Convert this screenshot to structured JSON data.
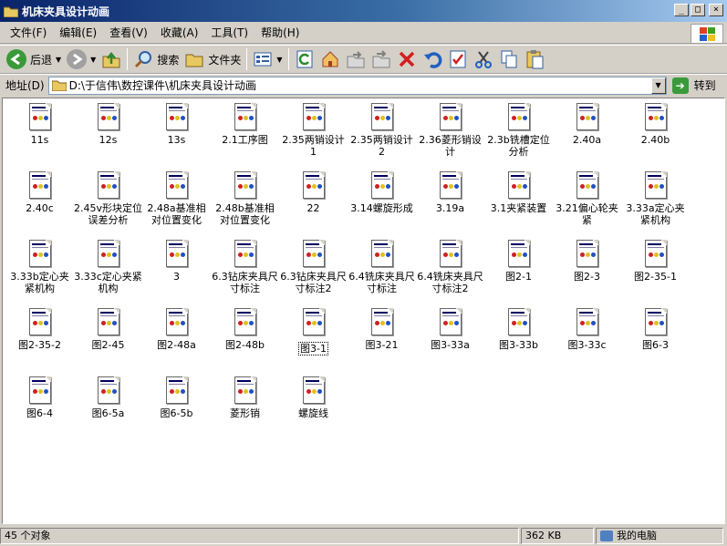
{
  "window": {
    "title": "机床夹具设计动画"
  },
  "menu": [
    "文件(F)",
    "编辑(E)",
    "查看(V)",
    "收藏(A)",
    "工具(T)",
    "帮助(H)"
  ],
  "toolbar": {
    "back_label": "后退",
    "search_label": "搜索",
    "folders_label": "文件夹"
  },
  "address": {
    "label": "地址(D)",
    "value": "D:\\于信伟\\数控课件\\机床夹具设计动画",
    "go_label": "转到"
  },
  "files": [
    "11s",
    "12s",
    "13s",
    "2.1工序图",
    "2.35两销设计1",
    "2.35两销设计2",
    "2.36菱形销设计",
    "2.3b铣槽定位分析",
    "2.40a",
    "2.40b",
    "2.40c",
    "2.45v形块定位误差分析",
    "2.48a基准相对位置变化",
    "2.48b基准相对位置变化",
    "22",
    "3.14螺旋形成",
    "3.19a",
    "3.1夹紧装置",
    "3.21偏心轮夹紧",
    "3.33a定心夹紧机构",
    "3.33b定心夹紧机构",
    "3.33c定心夹紧机构",
    "3",
    "6.3钻床夹具尺寸标注",
    "6.3钻床夹具尺寸标注2",
    "6.4铣床夹具尺寸标注",
    "6.4铣床夹具尺寸标注2",
    "图2-1",
    "图2-3",
    "图2-35-1",
    "图2-35-2",
    "图2-45",
    "图2-48a",
    "图2-48b",
    "图3-1",
    "图3-21",
    "图3-33a",
    "图3-33b",
    "图3-33c",
    "图6-3",
    "图6-4",
    "图6-5a",
    "图6-5b",
    "菱形销",
    "螺旋线"
  ],
  "selected_index": 34,
  "status": {
    "count": "45 个对象",
    "size": "362 KB",
    "location": "我的电脑"
  }
}
